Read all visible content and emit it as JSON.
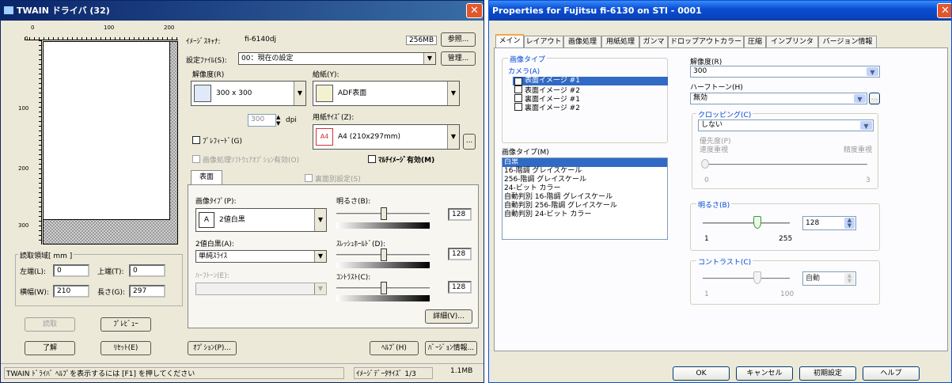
{
  "left_window": {
    "title": "TWAIN ドライバ (32)",
    "close_glyph": "✕",
    "ruler_top_labels": [
      "0",
      "100",
      "200"
    ],
    "ruler_left_labels": [
      "0",
      "100",
      "200",
      "300"
    ],
    "area_group_label": "読取領域[ mm ]",
    "left_label": "左端(L):",
    "left_value": "0",
    "top_label": "上端(T):",
    "top_value": "0",
    "width_label": "横幅(W):",
    "width_value": "210",
    "height_label": "長さ(G):",
    "height_value": "297",
    "scan_button": "読取",
    "preview_button": "ﾌﾟﾚﾋﾞｭｰ",
    "ok_button": "了解",
    "reset_button": "ﾘｾｯﾄ(E)",
    "scanner_label": "ｲﾒｰｼﾞｽｷｬﾅ:",
    "scanner_value": "fi-6140dj",
    "memory_badge": "256MB",
    "browse_button": "参照...",
    "settings_file_label": "設定ﾌｧｲﾙ(S):",
    "settings_file_value": "00：現在の設定",
    "manage_button": "管理...",
    "resolution_label": "解像度(R)",
    "resolution_value": "300 x 300",
    "custom_dpi_value": "300",
    "dpi_unit": "dpi",
    "prefeed_label": "ﾌﾟﾚﾌｨｰﾄﾞ(G)",
    "source_label": "給紙(Y):",
    "source_value": "ADF表面",
    "paper_size_label": "用紙ｻｲｽﾞ(Z):",
    "paper_size_value": "A4 (210x297mm)",
    "paper_more_button": "...",
    "software_option_label": "画像処理ｿﾌﾄｳｪｱｵﾌﾟｼｮﾝ有効(O)",
    "multi_image_label": "ﾏﾙﾁｲﾒｰｼﾞ有効(M)",
    "front_tab": "表面",
    "back_setting_label": "裏面別設定(S)",
    "image_type_label": "画像ﾀｲﾌﾟ(P):",
    "image_type_value": "2値白黒",
    "brightness_label": "明るさ(B):",
    "brightness_value": "128",
    "binary_label": "2値白黒(A):",
    "binary_value": "単純ｽﾗｲｽ",
    "threshold_label": "ｽﾚｯｼｭﾎｰﾙﾄﾞ(D):",
    "threshold_value": "128",
    "halftone_label": "ﾊｰﾌﾄｰﾝ(E):",
    "contrast_label": "ｺﾝﾄﾗｽﾄ(C):",
    "contrast_value": "128",
    "detail_button": "詳細(V)...",
    "option_button": "ｵﾌﾟｼｮﾝ(P)...",
    "help_button": "ﾍﾙﾌﾟ(H)",
    "version_button": "ﾊﾞｰｼﾞｮﾝ情報...",
    "status_text": "TWAIN ﾄﾞﾗｲﾊﾞ ﾍﾙﾌﾟを表示するには [F1] を押してください",
    "data_size_label": "ｲﾒｰｼﾞﾃﾞｰﾀｻｲｽﾞ 1/3",
    "data_size_value": "1.1MB",
    "title_bar_color": "#0a246a"
  },
  "right_window": {
    "title": "Properties for Fujitsu fi-6130 on STI - 0001",
    "close_glyph": "✕",
    "tabs": [
      "メイン",
      "レイアウト",
      "画像処理",
      "用紙処理",
      "ガンマ",
      "ドロップアウトカラー",
      "圧縮",
      "インプリンタ",
      "バージョン情報"
    ],
    "image_type_group": "画像タイプ",
    "camera_label": "カメラ(A)",
    "camera_items": [
      {
        "label": "表面イメージ #1",
        "checked": true,
        "selected": true
      },
      {
        "label": "表面イメージ #2",
        "checked": false,
        "selected": false
      },
      {
        "label": "裏面イメージ #1",
        "checked": false,
        "selected": false
      },
      {
        "label": "裏面イメージ #2",
        "checked": false,
        "selected": false
      }
    ],
    "image_type_list_label": "画像タイプ(M)",
    "image_type_items": [
      "白黒",
      "16-階調 グレイスケール",
      "256-階調 グレイスケール",
      "24-ビット カラー",
      "自動判別 16-階調 グレイスケール",
      "自動判別 256-階調 グレイスケール",
      "自動判別 24-ビット カラー"
    ],
    "resolution_label": "解像度(R)",
    "resolution_value": "300",
    "halftone_label": "ハーフトーン(H)",
    "halftone_value": "無効",
    "cropping_label": "クロッピング(C)",
    "cropping_value": "しない",
    "priority_label": "優先度(P)",
    "speed_label": "速度重視",
    "accuracy_label": "精度重視",
    "priority_min": "0",
    "priority_max": "3",
    "brightness_label": "明るさ(B)",
    "brightness_value": "128",
    "brightness_min": "1",
    "brightness_max": "255",
    "contrast_label": "コントラスト(C)",
    "contrast_value": "自動",
    "contrast_min": "1",
    "contrast_max": "100",
    "ok_button": "OK",
    "cancel_button": "キャンセル",
    "default_button": "初期設定",
    "help_button": "ヘルプ",
    "title_bar_color": "#0a4fd6",
    "tab_accent": "#f3a64c",
    "label_color": "#0046d5"
  }
}
